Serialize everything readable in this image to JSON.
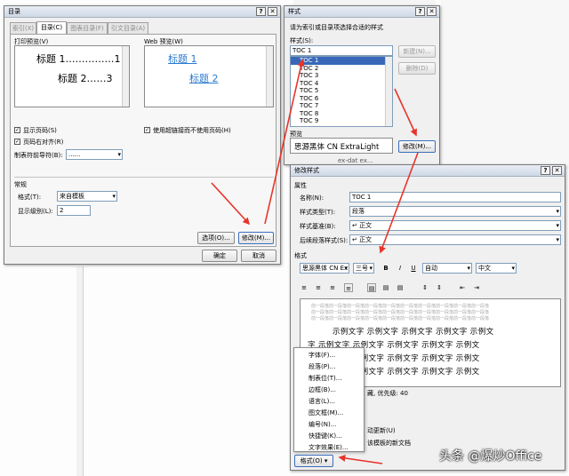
{
  "toc_dialog": {
    "title": "目录",
    "tabs": [
      "索引(X)",
      "目录(C)",
      "图表目录(F)",
      "引文目录(A)"
    ],
    "print_preview_label": "打印预览(V)",
    "print_preview_lines": [
      "标题 1……………1",
      "标题 2……3"
    ],
    "web_preview_label": "Web 预览(W)",
    "web_preview_lines": [
      "标题 1",
      "标题 2"
    ],
    "show_page_numbers": "显示页码(S)",
    "right_align_page_numbers": "页码右对齐(R)",
    "tab_leader_label": "制表符前导符(B):",
    "tab_leader_value": "......",
    "use_hyperlinks": "使用超链接而不使用页码(H)",
    "general_label": "常规",
    "formats_label": "格式(T):",
    "formats_value": "来自模板",
    "show_levels_label": "显示级别(L):",
    "show_levels_value": "2",
    "options_button": "选项(O)...",
    "modify_button": "修改(M)...",
    "ok_button": "确定",
    "cancel_button": "取消"
  },
  "style_dialog": {
    "title": "样式",
    "instruction": "请为索引或目录项选择合适的样式",
    "styles_label": "样式(S):",
    "styles_input": "TOC 1",
    "style_items": [
      "TOC 1",
      "TOC 2",
      "TOC 3",
      "TOC 4",
      "TOC 5",
      "TOC 6",
      "TOC 7",
      "TOC 8",
      "TOC 9"
    ],
    "new_button": "新建(N)...",
    "delete_button": "删除(D)",
    "preview_label": "预览",
    "preview_font": "思源黑体 CN ExtraLight",
    "modify_button": "修改(M)...",
    "desc_partial": "ex-dat  ex..."
  },
  "modify_dialog": {
    "title": "修改样式",
    "properties_label": "属性",
    "name_label": "名称(N):",
    "name_value": "TOC 1",
    "type_label": "样式类型(T):",
    "type_value": "段落",
    "based_on_label": "样式基准(B):",
    "based_on_value": "↵ 正文",
    "following_label": "后续段落样式(S):",
    "following_value": "↵ 正文",
    "format_label": "格式",
    "font_value": "思源黑体 CN Ex",
    "size_value": "三号",
    "bold": "B",
    "italic": "I",
    "underline": "U",
    "color_value": "自动",
    "lang_value": "中文",
    "prev_para_text": "前一段落前一段落前一段落前一段落前一段落前一段落前一段落前一段落前一段落前一段落",
    "sample_rows": [
      "示例文字 示例文字 示例文字 示例文字 示例文",
      "字 示例文字 示例文字 示例文字 示例文字 示例文",
      "字 示例文字 示例文字 示例文字 示例文字 示例文",
      "字 示例文字 示例文字 示例文字 示例文字 示例文"
    ],
    "desc_text": "藏, 优先级: 40",
    "auto_update": "动更新(U)",
    "template_docs": "该模板的新文档",
    "format_button": "格式(O) ▾"
  },
  "format_menu": {
    "items": [
      "字体(F)...",
      "段落(P)...",
      "制表位(T)...",
      "边框(B)...",
      "语言(L)...",
      "图文框(M)...",
      "编号(N)...",
      "快捷键(K)...",
      "文字效果(E)..."
    ]
  },
  "watermark": "头条 @爆炒Office"
}
